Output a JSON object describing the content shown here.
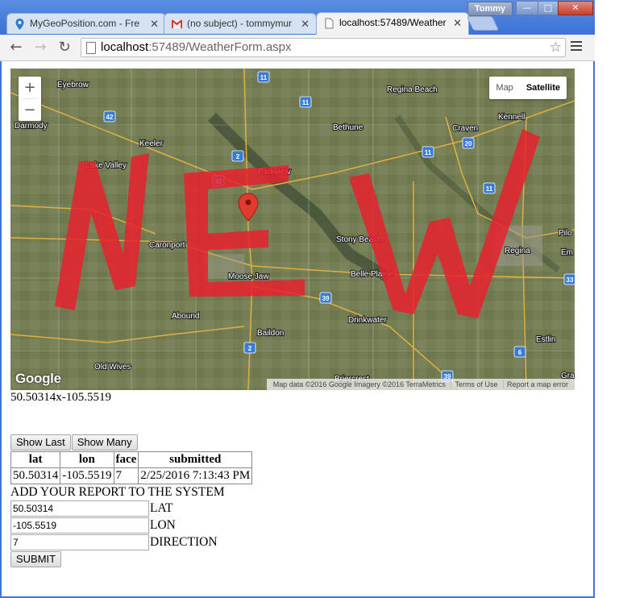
{
  "window": {
    "user": "Tommy",
    "controls": {
      "minimize": "—",
      "maximize": "□",
      "close": "✕"
    }
  },
  "tabs": [
    {
      "title": "MyGeoPosition.com - Fre",
      "icon": "map-pin-icon"
    },
    {
      "title": "(no subject) - tommymur",
      "icon": "gmail-icon"
    },
    {
      "title": "localhost:57489/Weather",
      "icon": "page-icon",
      "active": true
    }
  ],
  "toolbar": {
    "url_host": "localhost",
    "url_path": ":57489/WeatherForm.aspx"
  },
  "map": {
    "overlay_text": "NEW",
    "map_type_options": [
      "Map",
      "Satellite"
    ],
    "selected_map_type": "Satellite",
    "zoom_in": "+",
    "zoom_out": "−",
    "logo": "Google",
    "attribution": [
      "Map data ©2016 Google Imagery ©2016 TerraMetrics",
      "Terms of Use",
      "Report a map error"
    ],
    "places": [
      "Eyebrow",
      "Darmody",
      "Keeler",
      "Lake Valley",
      "Bethune",
      "Craven",
      "Kennell",
      "Regina Beach",
      "Parkview",
      "Caronport",
      "Moose Jaw",
      "Stony Beach",
      "Belle Plaine",
      "Regina",
      "Pilo",
      "Em",
      "Abound",
      "Baildon",
      "Drinkwater",
      "Estlin",
      "Old Wives",
      "Gra",
      "Briercrest"
    ],
    "roads": [
      "11",
      "11",
      "11",
      "11",
      "42",
      "42",
      "2",
      "2",
      "20",
      "39",
      "39",
      "6",
      "33"
    ],
    "accent_color": "#e8212e"
  },
  "position_readout": "50.50314x-105.5519",
  "buttons": {
    "show_last": "Show Last",
    "show_many": "Show Many"
  },
  "reports": {
    "columns": [
      "lat",
      "lon",
      "face",
      "submitted"
    ],
    "rows": [
      [
        "50.50314",
        "-105.5519",
        "7",
        "2/25/2016 7:13:43 PM"
      ]
    ]
  },
  "form": {
    "heading": "ADD YOUR REPORT TO THE SYSTEM",
    "lat_value": "50.50314",
    "lat_label": "LAT",
    "lon_value": "-105.5519",
    "lon_label": "LON",
    "direction_value": "7",
    "direction_label": "DIRECTION",
    "submit_label": "SUBMIT"
  }
}
